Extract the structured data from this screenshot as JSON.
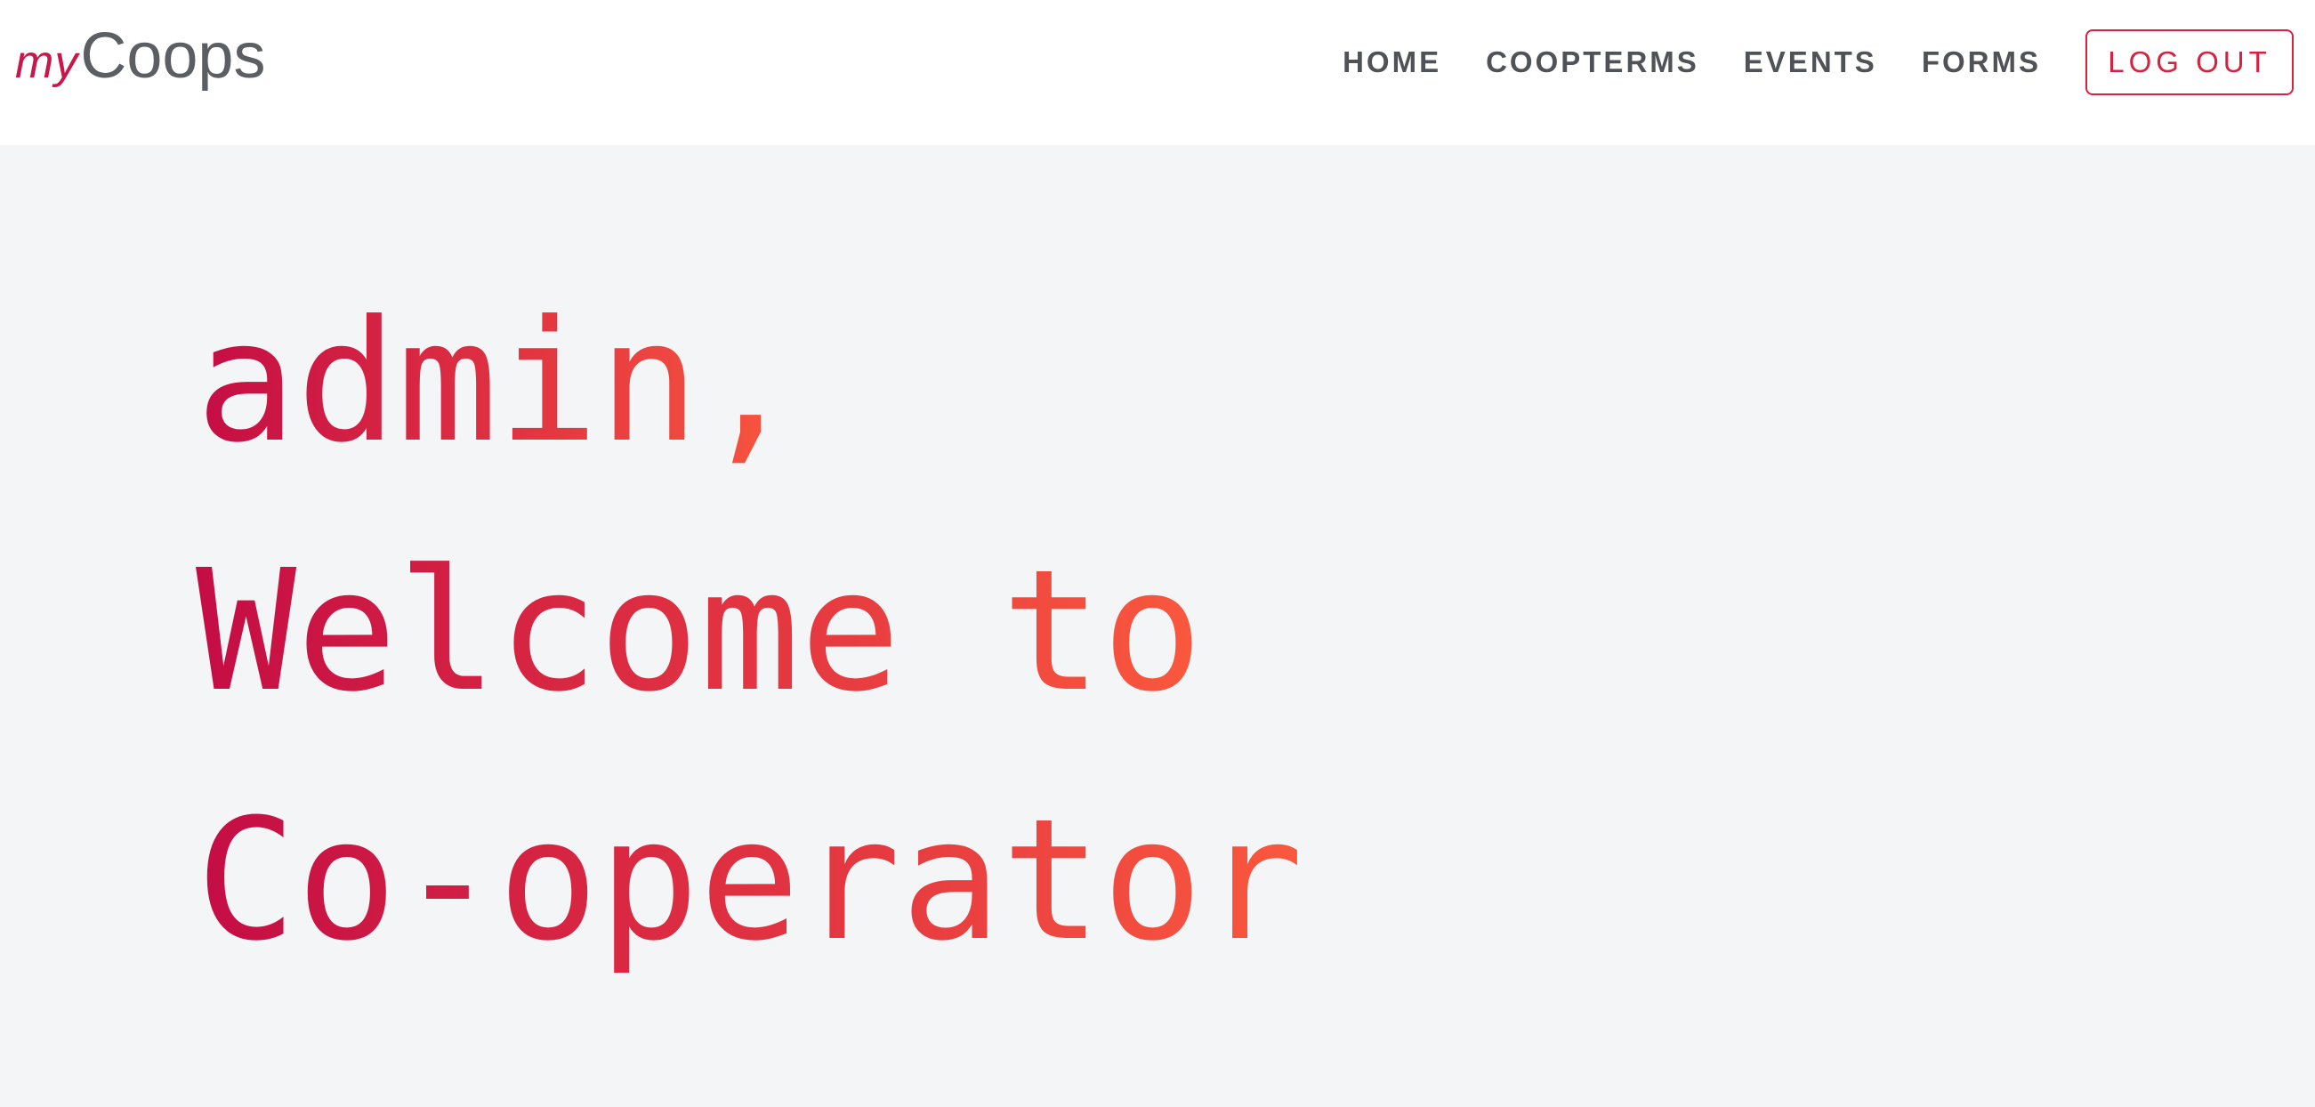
{
  "logo": {
    "prefix": "my",
    "name": "Coops"
  },
  "nav": {
    "items": [
      {
        "label": "HOME"
      },
      {
        "label": "COOPTERMS"
      },
      {
        "label": "EVENTS"
      },
      {
        "label": "FORMS"
      }
    ],
    "logout_label": "LOG OUT"
  },
  "hero": {
    "line1": "admin,",
    "line2": "Welcome to",
    "line3": "Co-operator"
  },
  "colors": {
    "brand": "#c8184a",
    "gradient_start": "#c40d45",
    "gradient_end": "#fb5a3e",
    "nav_text": "#4f5357",
    "background": "#f4f5f7"
  }
}
